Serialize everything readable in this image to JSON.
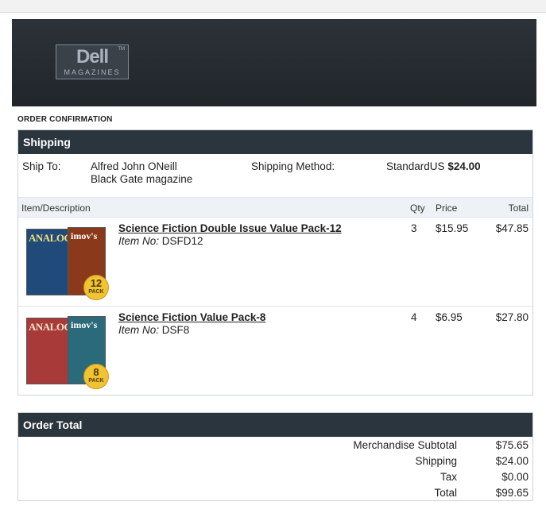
{
  "brand": {
    "logo_main": "Dell",
    "logo_tm": "TM",
    "logo_sub": "MAGAZINES"
  },
  "page_title": "ORDER CONFIRMATION",
  "shipping": {
    "header": "Shipping",
    "ship_to_label": "Ship To:",
    "address_line1": "Alfred John ONeill",
    "address_line2": "Black Gate magazine",
    "method_label": "Shipping Method:",
    "method_name": "StandardUS",
    "method_cost": "$24.00"
  },
  "items_table": {
    "columns": {
      "item": "Item/Description",
      "qty": "Qty",
      "price": "Price",
      "total": "Total"
    },
    "rows": [
      {
        "name": "Science Fiction Double Issue Value Pack-12",
        "item_no_label": "Item No:",
        "item_no": "DSFD12",
        "qty": "3",
        "price": "$15.95",
        "total": "$47.85",
        "cover1_title": "ANALOG",
        "cover2_title": "imov's",
        "badge_number": "12",
        "badge_text": "PACK",
        "cover1_color": "#1f4a7a",
        "cover2_color": "#8a3a1a"
      },
      {
        "name": "Science Fiction Value Pack-8",
        "item_no_label": "Item No:",
        "item_no": "DSF8",
        "qty": "4",
        "price": "$6.95",
        "total": "$27.80",
        "cover1_title": "ANALOG",
        "cover2_title": "imov's",
        "badge_number": "8",
        "badge_text": "PACK",
        "cover1_color": "#a83a3a",
        "cover2_color": "#2a6a7a"
      }
    ]
  },
  "order_total": {
    "header": "Order Total",
    "subtotal_label": "Merchandise Subtotal",
    "subtotal": "$75.65",
    "shipping_label": "Shipping",
    "shipping": "$24.00",
    "tax_label": "Tax",
    "tax": "$0.00",
    "total_label": "Total",
    "total": "$99.65"
  },
  "colors": {
    "banner": "#23292e",
    "panel_header": "#2b353d",
    "table_header": "#eef2f6",
    "badge": "#f1c232"
  }
}
